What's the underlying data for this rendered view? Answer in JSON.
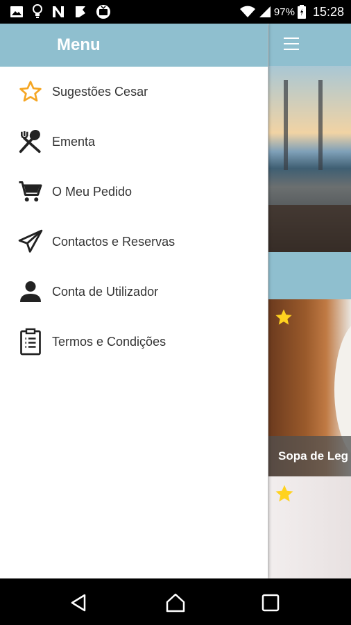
{
  "status_bar": {
    "battery": "97%",
    "time": "15:28",
    "icons": [
      "image-icon",
      "lightbulb-icon",
      "n-logo-icon",
      "f-logo-icon",
      "tv-icon",
      "wifi-icon",
      "signal-icon",
      "battery-icon"
    ]
  },
  "drawer": {
    "title": "Menu",
    "items": [
      {
        "label": "Sugestões Cesar",
        "icon": "star-outline-icon"
      },
      {
        "label": "Ementa",
        "icon": "utensils-icon"
      },
      {
        "label": "O Meu Pedido",
        "icon": "cart-icon"
      },
      {
        "label": "Contactos e Reservas",
        "icon": "send-icon"
      },
      {
        "label": "Conta de Utilizador",
        "icon": "user-icon"
      },
      {
        "label": "Termos e Condições",
        "icon": "clipboard-icon"
      }
    ]
  },
  "background_app": {
    "card_title": "Sopa de Leg"
  },
  "colors": {
    "header": "#8fbfcf",
    "star": "#f5a623",
    "text": "#333333"
  },
  "nav_bar": {
    "icons": [
      "back-icon",
      "home-icon",
      "recents-icon"
    ]
  }
}
